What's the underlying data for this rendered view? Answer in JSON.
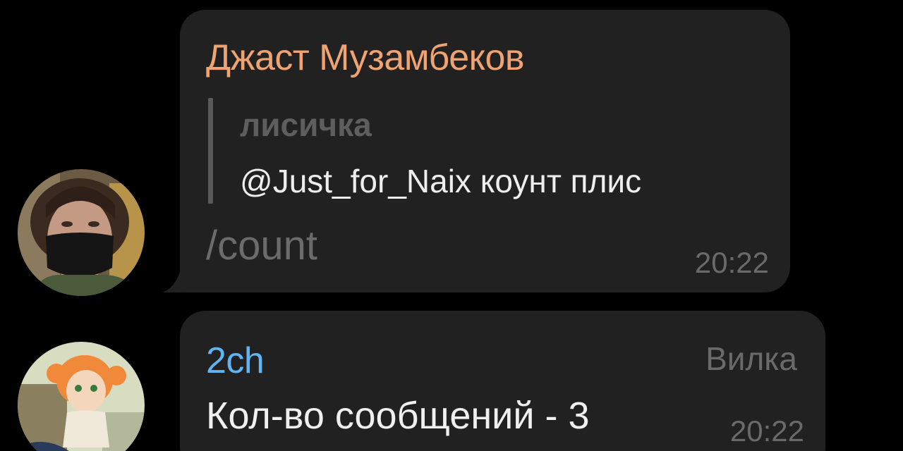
{
  "messages": [
    {
      "sender": "Джаст Музамбеков",
      "sender_color": "#f0a372",
      "reply": {
        "author": "лисичка",
        "text": "@Just_for_Naix коунт плис"
      },
      "text": "/count",
      "time": "20:22"
    },
    {
      "sender": "2ch",
      "sender_color": "#5fb4f2",
      "badge": "Вилка",
      "text": "Кол-во сообщений - 3",
      "time": "20:22"
    }
  ]
}
